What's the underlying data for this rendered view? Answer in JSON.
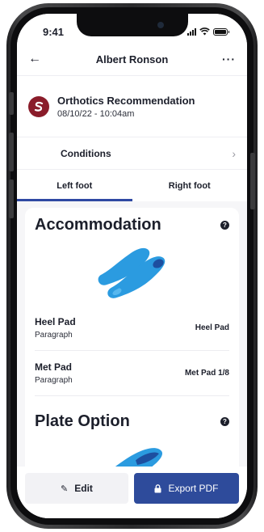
{
  "status": {
    "time": "9:41"
  },
  "nav": {
    "title": "Albert Ronson",
    "back_icon": "arrow-left-icon",
    "more_icon": "ellipsis-icon"
  },
  "header": {
    "logo_letter": "S",
    "title": "Orthotics Recommendation",
    "date": "08/10/22 - 10:04am"
  },
  "conditions": {
    "label": "Conditions"
  },
  "tabs": [
    {
      "label": "Left foot",
      "active": true
    },
    {
      "label": "Right foot",
      "active": false
    }
  ],
  "sections": {
    "accommodation": {
      "title": "Accommodation",
      "rows": [
        {
          "name": "Heel Pad",
          "sub": "Paragraph",
          "value": "Heel Pad"
        },
        {
          "name": "Met Pad",
          "sub": "Paragraph",
          "value": "Met Pad 1/8"
        }
      ]
    },
    "plate": {
      "title": "Plate Option"
    }
  },
  "footer": {
    "edit_label": "Edit",
    "export_label": "Export PDF"
  },
  "colors": {
    "accent": "#2e4b9b",
    "insole": "#2b9be0",
    "insole_dark": "#1d4fa0",
    "brand": "#8a1c2a"
  }
}
